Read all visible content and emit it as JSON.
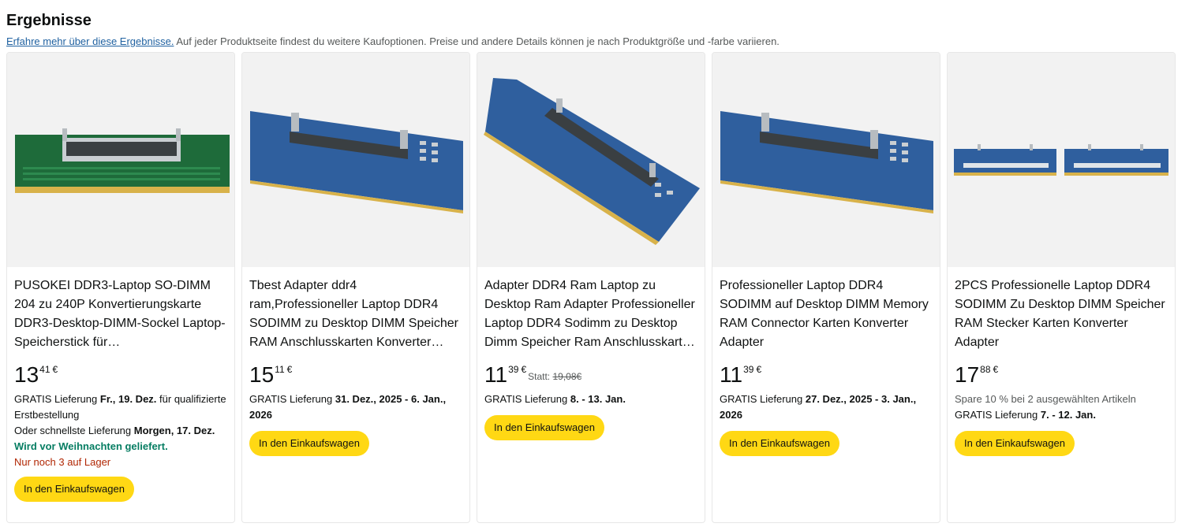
{
  "header": {
    "title": "Ergebnisse",
    "link": "Erfahre mehr über diese Ergebnisse.",
    "note": " Auf jeder Produktseite findest du weitere Kaufoptionen. Preise und andere Details können je nach Produktgröße und -farbe variieren."
  },
  "products": [
    {
      "title": "PUSOKEI DDR3-Laptop SO-DIMM 204 zu 240P Konvertierungskarte DDR3-Desktop-DIMM-Sockel Laptop-Speicherstick für Computerspeicherkarten",
      "price_whole": "13",
      "price_fraction": "41",
      "currency": "€",
      "delivery_prefix": "GRATIS Lieferung ",
      "delivery_date": "Fr., 19. Dez.",
      "delivery_suffix": " für qualifizierte Erstbestellung",
      "fastest_prefix": "Oder schnellste Lieferung ",
      "fastest_date": "Morgen, 17. Dez.",
      "christmas": "Wird vor Weihnachten geliefert.",
      "stock": "Nur noch 3 auf Lager",
      "button": "In den Einkaufswagen",
      "image": "green-ddr3-adapter"
    },
    {
      "title": "Tbest Adapter ddr4 ram,Professioneller Laptop DDR4 SODIMM zu Desktop DIMM Speicher RAM Anschlusskarten Konverter Adapter",
      "price_whole": "15",
      "price_fraction": "11",
      "currency": "€",
      "delivery_prefix": "GRATIS Lieferung ",
      "delivery_date": "31. Dez., 2025 - 6. Jan., 2026",
      "button": "In den Einkaufswagen",
      "image": "blue-ddr4-adapter"
    },
    {
      "title": "Adapter DDR4 Ram Laptop zu Desktop Ram Adapter Professioneller Laptop DDR4 Sodimm zu Desktop Dimm Speicher Ram Anschlusskarten Konverter",
      "price_whole": "11",
      "price_fraction": "39",
      "currency": "€",
      "statt_label": "Statt: ",
      "statt_price": "19,08€",
      "delivery_prefix": "GRATIS Lieferung ",
      "delivery_date": "8. - 13. Jan.",
      "button": "In den Einkaufswagen",
      "image": "blue-ddr4-adapter-tilted"
    },
    {
      "title": "Professioneller Laptop DDR4 SODIMM auf Desktop DIMM Memory RAM Connector Karten Konverter Adapter",
      "price_whole": "11",
      "price_fraction": "39",
      "currency": "€",
      "delivery_prefix": "GRATIS Lieferung ",
      "delivery_date": "27. Dez., 2025 - 3. Jan., 2026",
      "button": "In den Einkaufswagen",
      "image": "blue-ddr4-adapter"
    },
    {
      "title": "2PCS Professionelle Laptop DDR4 SODIMM Zu Desktop DIMM Speicher RAM Stecker Karten Konverter Adapter",
      "price_whole": "17",
      "price_fraction": "88",
      "currency": "€",
      "promo": "Spare 10 % bei 2 ausgewählten Artikeln",
      "delivery_prefix": "GRATIS Lieferung ",
      "delivery_date": "7. - 12. Jan.",
      "button": "In den Einkaufswagen",
      "image": "two-blue-ddr4-adapters"
    }
  ]
}
